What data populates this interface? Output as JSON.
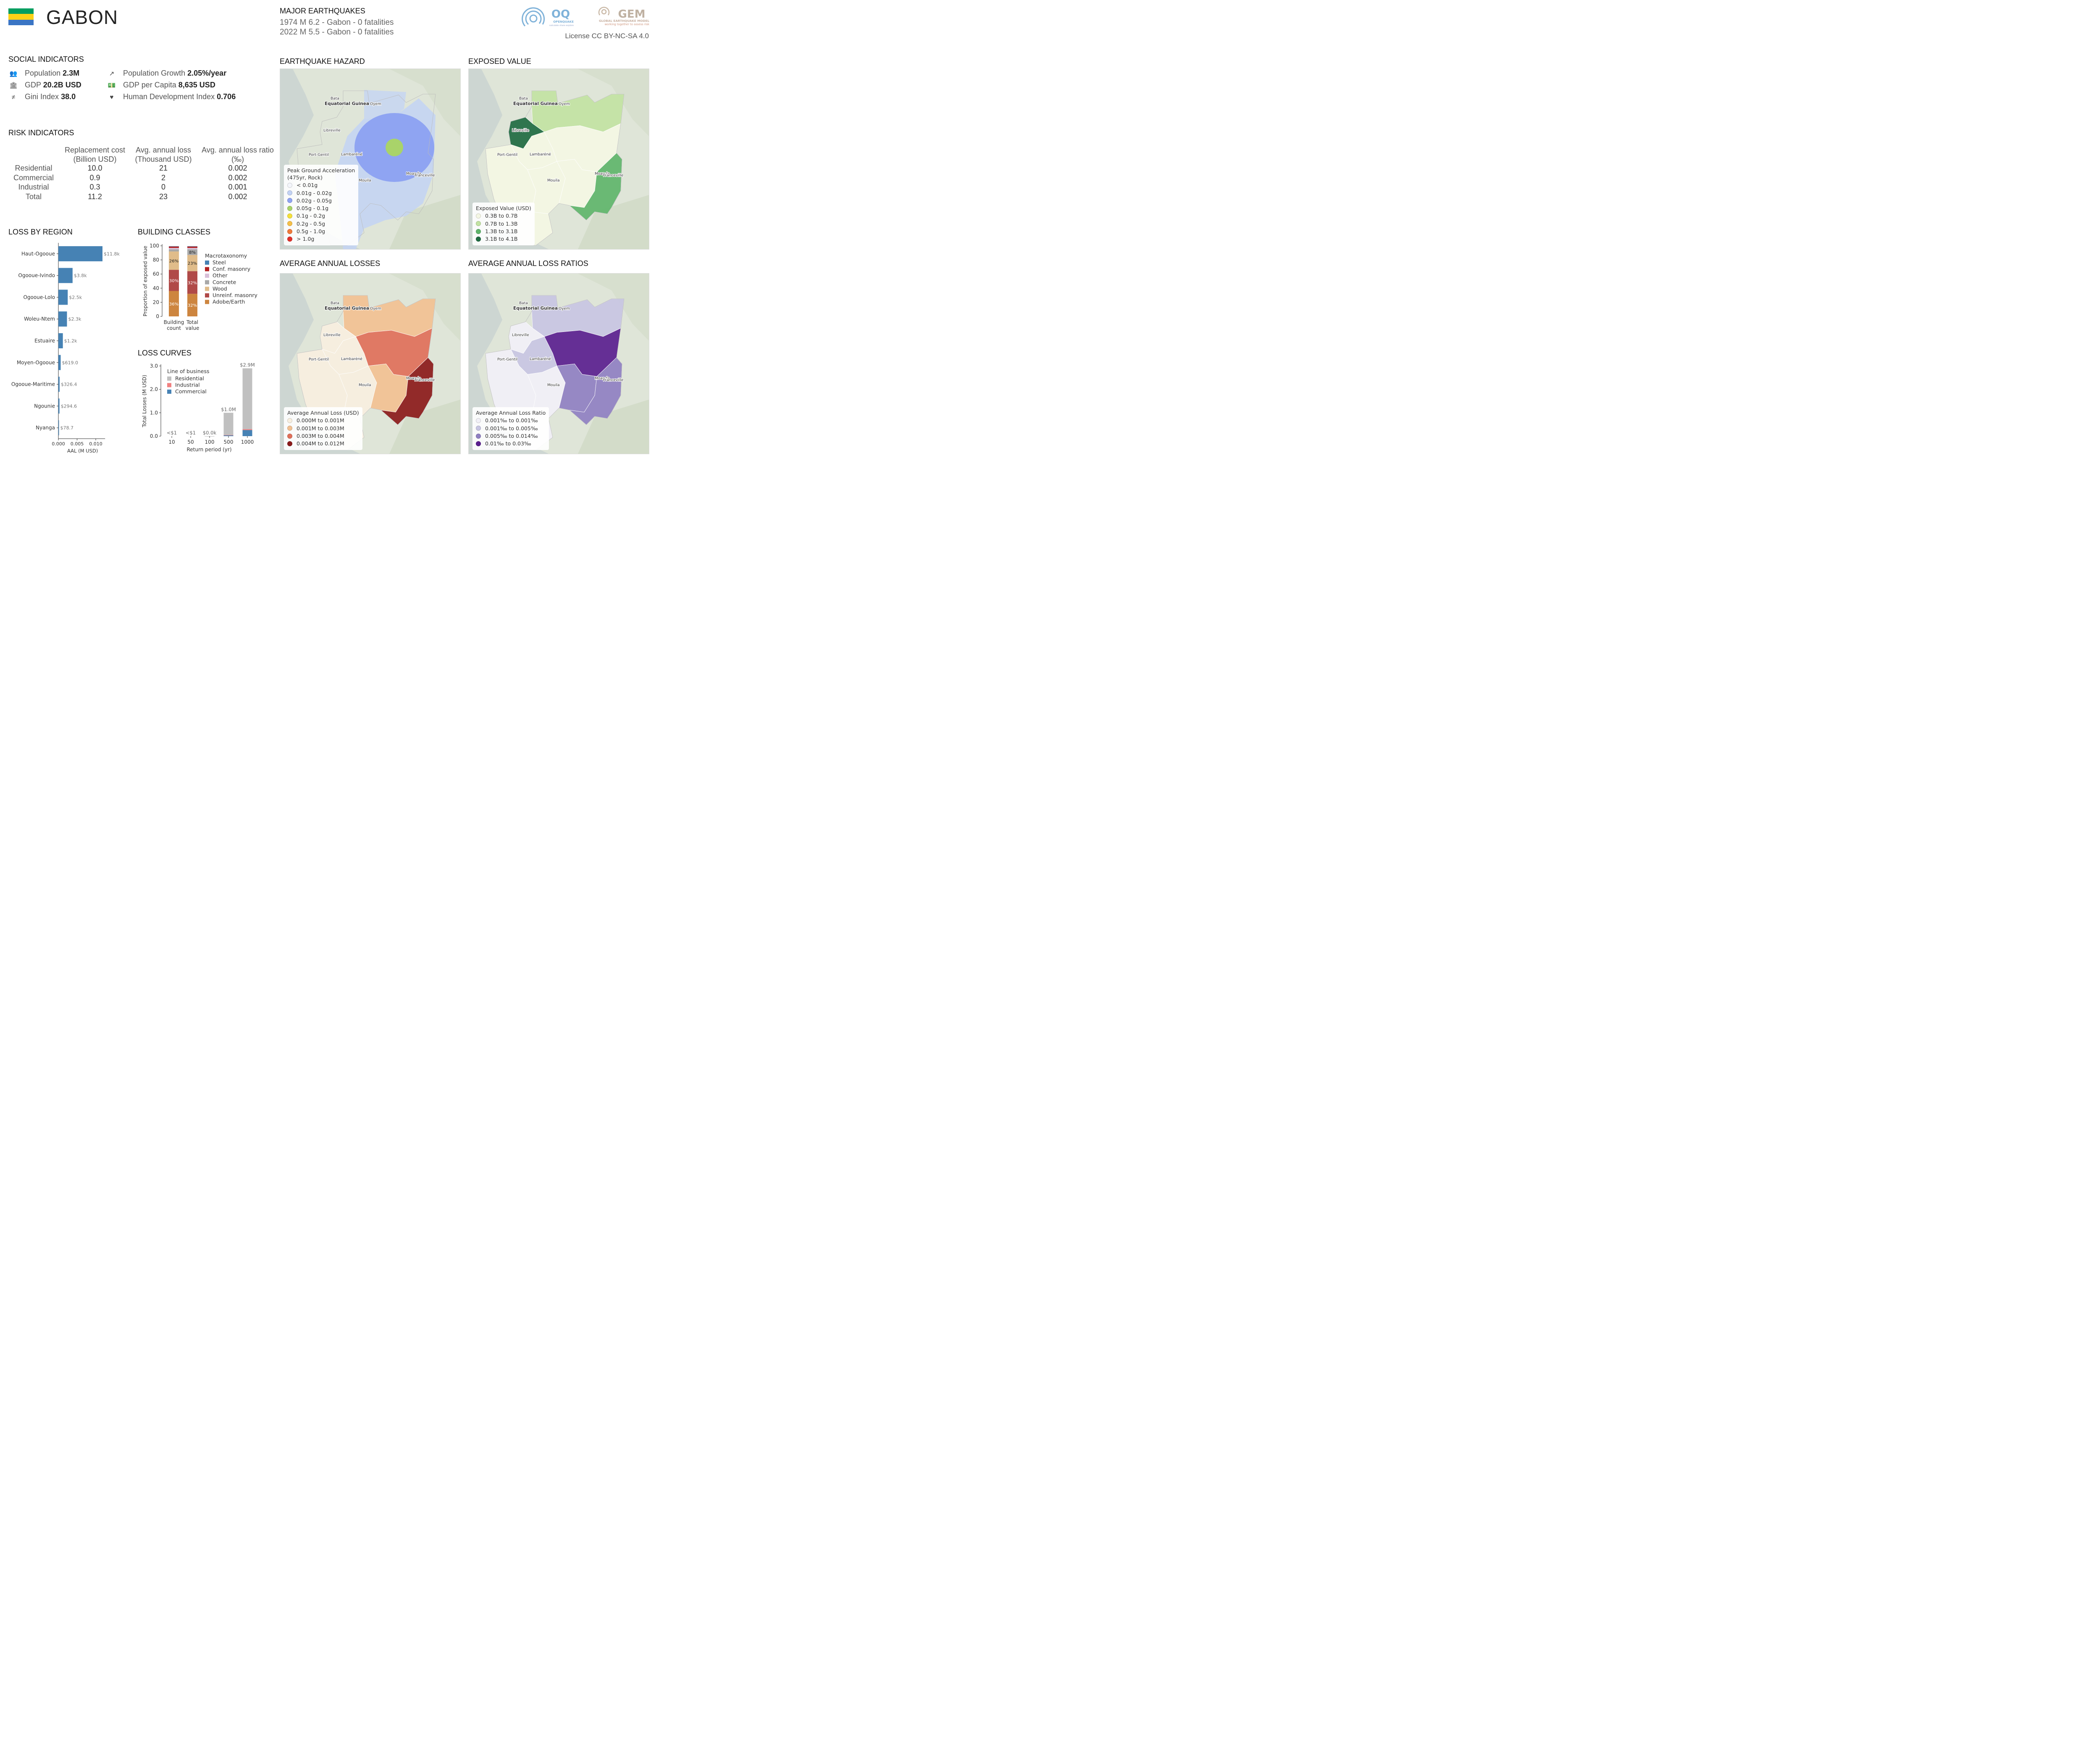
{
  "header": {
    "country": "GABON",
    "flag_colors": [
      "#009E60",
      "#FCD116",
      "#3A75C4"
    ],
    "major_title": "MAJOR EARTHQUAKES",
    "events": [
      "1974 M 6.2 - Gabon - 0 fatalities",
      "2022 M 5.5 - Gabon - 0 fatalities"
    ],
    "license": "License CC BY-NC-SA 4.0",
    "oq_logo": {
      "name": "OQ",
      "line1": "OPENQUAKE",
      "line2": "calculate share explore"
    },
    "gem_logo": {
      "name": "GEM",
      "line1": "GLOBAL EARTHQUAKE MODEL",
      "line2": "working together to assess risk"
    }
  },
  "social": {
    "title": "SOCIAL INDICATORS",
    "items": [
      {
        "icon": "people-icon",
        "label": "Population",
        "value": "2.3M"
      },
      {
        "icon": "trend-up-icon",
        "label": "Population Growth",
        "value": "2.05%/year"
      },
      {
        "icon": "bank-icon",
        "label": "GDP",
        "value": "20.2B USD"
      },
      {
        "icon": "money-icon",
        "label": "GDP per Capita",
        "value": "8,635 USD"
      },
      {
        "icon": "not-equal-icon",
        "label": "Gini Index",
        "value": "38.0"
      },
      {
        "icon": "heartbeat-icon",
        "label": "Human Development Index",
        "value": "0.706"
      }
    ]
  },
  "risk": {
    "title": "RISK INDICATORS",
    "columns": [
      {
        "line1": "Replacement cost",
        "line2": "(Billion USD)"
      },
      {
        "line1": "Avg. annual loss",
        "line2": "(Thousand USD)"
      },
      {
        "line1": "Avg. annual loss ratio",
        "line2": "(‰)"
      }
    ],
    "rows": [
      {
        "label": "Residential",
        "values": [
          "10.0",
          "21",
          "0.002"
        ]
      },
      {
        "label": "Commercial",
        "values": [
          "0.9",
          "2",
          "0.002"
        ]
      },
      {
        "label": "Industrial",
        "values": [
          "0.3",
          "0",
          "0.001"
        ]
      },
      {
        "label": "Total",
        "values": [
          "11.2",
          "23",
          "0.002"
        ]
      }
    ]
  },
  "chart_data": [
    {
      "id": "loss_by_region",
      "type": "bar",
      "orientation": "horizontal",
      "title": "LOSS BY REGION",
      "xlabel": "AAL (M USD)",
      "xlim": [
        0,
        0.0125
      ],
      "xticks": [
        "0.000",
        "0.005",
        "0.010"
      ],
      "color": "#4682b4",
      "categories": [
        "Haut-Ogooue",
        "Ogooue-Ivindo",
        "Ogooue-Lolo",
        "Woleu-Ntem",
        "Estuaire",
        "Moyen-Ogooue",
        "Ogooue-Maritime",
        "Ngounie",
        "Nyanga"
      ],
      "values": [
        0.0118,
        0.0038,
        0.0025,
        0.0023,
        0.0012,
        0.000619,
        0.000326,
        0.000295,
        7.87e-05
      ],
      "labels": [
        "$11.8k",
        "$3.8k",
        "$2.5k",
        "$2.3k",
        "$1.2k",
        "$619.0",
        "$326.4",
        "$294.6",
        "$78.7"
      ]
    },
    {
      "id": "building_classes",
      "type": "bar",
      "stacked": true,
      "title": "BUILDING CLASSES",
      "ylabel": "Proportion of exposed value",
      "ylim": [
        0,
        100
      ],
      "yticks": [
        "0",
        "20",
        "40",
        "60",
        "80",
        "100"
      ],
      "categories": [
        "Building\ncount",
        "Total\nvalue"
      ],
      "legend_title": "Macrotaxonomy",
      "series": [
        {
          "name": "Adobe/Earth",
          "color": "#cd853f",
          "values": [
            36,
            32
          ],
          "labels": [
            "36%",
            "32%"
          ]
        },
        {
          "name": "Unreinf. masonry",
          "color": "#b04a48",
          "values": [
            30,
            32
          ],
          "labels": [
            "30%",
            "32%"
          ]
        },
        {
          "name": "Wood",
          "color": "#e0bc8a",
          "values": [
            26,
            23
          ],
          "labels": [
            "26%",
            "23%"
          ]
        },
        {
          "name": "Concrete",
          "color": "#a8a8a8",
          "values": [
            3,
            8
          ],
          "labels": [
            "",
            "8%"
          ]
        },
        {
          "name": "Other",
          "color": "#d8bfd8",
          "values": [
            2,
            2
          ],
          "labels": [
            "",
            ""
          ]
        },
        {
          "name": "Conf. masonry",
          "color": "#b22222",
          "values": [
            2,
            2
          ],
          "labels": [
            "",
            ""
          ]
        },
        {
          "name": "Steel",
          "color": "#4682b4",
          "values": [
            0.5,
            0.5
          ],
          "labels": [
            "",
            ""
          ]
        }
      ]
    },
    {
      "id": "loss_curves",
      "type": "bar",
      "stacked": true,
      "title": "LOSS CURVES",
      "xlabel": "Return period (yr)",
      "ylabel": "Total Losses (M USD)",
      "ylim": [
        0,
        3.0
      ],
      "yticks": [
        "0.0",
        "1.0",
        "2.0",
        "3.0"
      ],
      "categories": [
        "10",
        "50",
        "100",
        "500",
        "1000"
      ],
      "legend_title": "Line of business",
      "totals": [
        "<$1",
        "<$1",
        "$0.0k",
        "$1.0M",
        "$2.9M"
      ],
      "series": [
        {
          "name": "Commercial",
          "color": "#4682b4",
          "values": [
            0,
            0,
            0,
            0.04,
            0.26
          ]
        },
        {
          "name": "Industrial",
          "color": "#f08080",
          "values": [
            0,
            0,
            0,
            0.01,
            0.04
          ]
        },
        {
          "name": "Residential",
          "color": "#c0c0c0",
          "values": [
            0,
            0,
            0.002,
            0.95,
            2.6
          ]
        }
      ]
    }
  ],
  "maps": {
    "labels": {
      "bata": "Bata",
      "eq_guinea": "Equatorial Guinea",
      "oyem": "Oyem",
      "libreville": "Libreville",
      "port_gentil": "Port-Gentil",
      "lambarene": "Lambaréné",
      "mouila": "Mouila",
      "moanda": "Moanda",
      "franceville": "Franceville"
    },
    "hazard": {
      "title": "EARTHQUAKE HAZARD",
      "legend_title": "Peak Ground Acceleration",
      "legend_subtitle": "(475yr, Rock)",
      "items": [
        {
          "label": "< 0.01g",
          "color": "#f4f6fb"
        },
        {
          "label": "0.01g - 0.02g",
          "color": "#c3d3f5"
        },
        {
          "label": "0.02g - 0.05g",
          "color": "#8fa4f2"
        },
        {
          "label": "0.05g - 0.1g",
          "color": "#a9d36a"
        },
        {
          "label": "0.1g - 0.2g",
          "color": "#f5e03a"
        },
        {
          "label": "0.2g - 0.5g",
          "color": "#f6c048"
        },
        {
          "label": "0.5g - 1.0g",
          "color": "#f07a3a"
        },
        {
          "label": "> 1.0g",
          "color": "#e0302a"
        }
      ]
    },
    "exposed": {
      "title": "EXPOSED VALUE",
      "legend_title": "Exposed Value (USD)",
      "items": [
        {
          "label": "0.3B to 0.7B",
          "color": "#f4f7e4"
        },
        {
          "label": "0.7B to 1.3B",
          "color": "#c2e3a3"
        },
        {
          "label": "1.3B to 3.1B",
          "color": "#5fb56b"
        },
        {
          "label": "3.1B to 4.1B",
          "color": "#1f6b42"
        }
      ]
    },
    "aal": {
      "title": "AVERAGE ANNUAL LOSSES",
      "legend_title": "Average Annual Loss (USD)",
      "items": [
        {
          "label": "0.000M to 0.001M",
          "color": "#f7efe0"
        },
        {
          "label": "0.001M to 0.003M",
          "color": "#f2c193"
        },
        {
          "label": "0.003M to 0.004M",
          "color": "#e0705a"
        },
        {
          "label": "0.004M to 0.012M",
          "color": "#8b1a1a"
        }
      ]
    },
    "aalr": {
      "title": "AVERAGE ANNUAL LOSS RATIOS",
      "legend_title": "Average Annual Loss Ratio",
      "items": [
        {
          "label": "0.001‰ to 0.001‰",
          "color": "#f1f0f7"
        },
        {
          "label": "0.001‰ to 0.005‰",
          "color": "#c8c6e3"
        },
        {
          "label": "0.005‰ to 0.014‰",
          "color": "#8f80c2"
        },
        {
          "label": "0.01‰ to 0.03‰",
          "color": "#5a1f8f"
        }
      ]
    }
  }
}
